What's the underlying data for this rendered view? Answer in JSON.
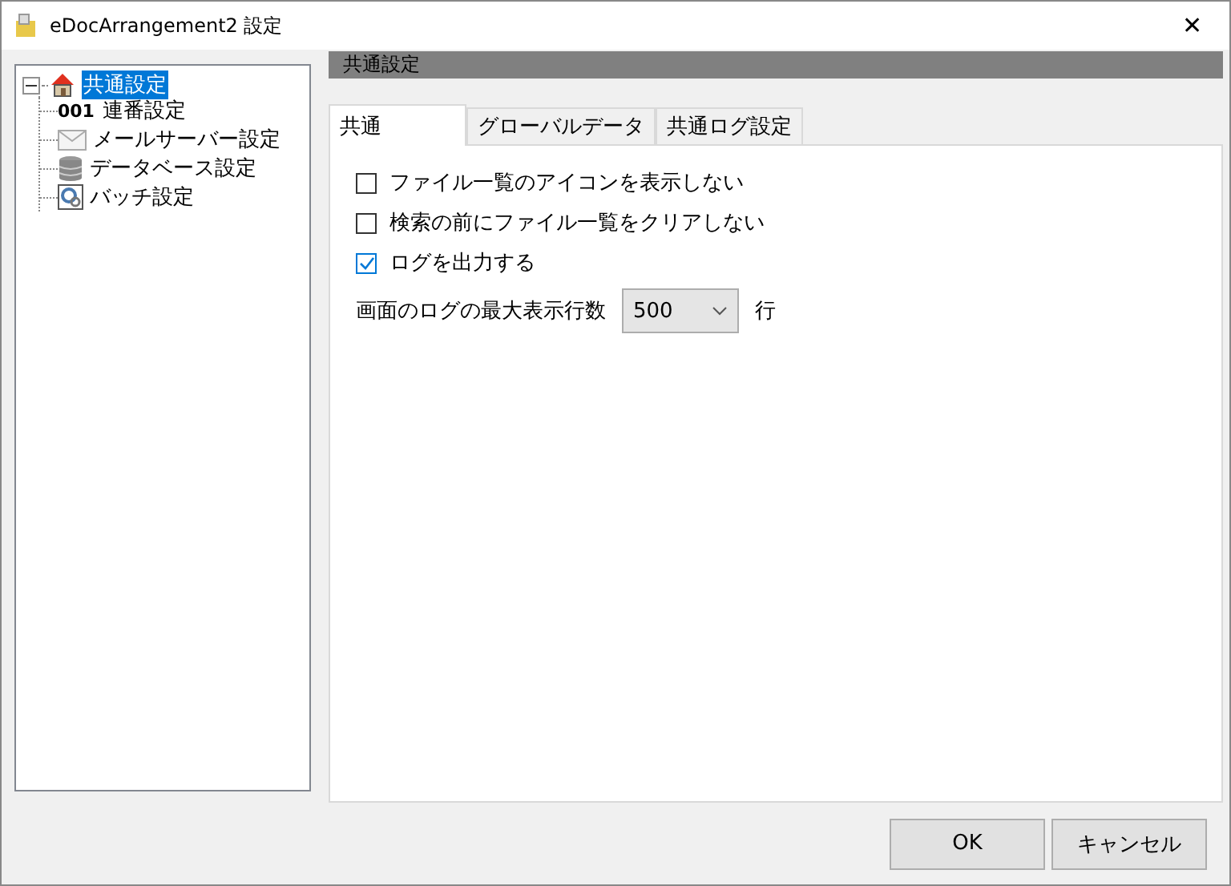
{
  "window": {
    "title": "eDocArrangement2 設定",
    "close": "✕"
  },
  "tree": [
    {
      "label": "共通設定",
      "kind": "house",
      "selected": true,
      "expanded": true,
      "children": [
        {
          "label": "連番設定",
          "badge": "001",
          "selected": false
        },
        {
          "label": "メールサーバー設定",
          "kind": "mail",
          "selected": false
        },
        {
          "label": "データベース設定",
          "kind": "database",
          "selected": false
        },
        {
          "label": "バッチ設定",
          "kind": "gear",
          "selected": false
        }
      ]
    }
  ],
  "section_header": "共通設定",
  "tabs": [
    {
      "label": "共通",
      "selected": true
    },
    {
      "label": "グローバルデータ",
      "selected": false
    },
    {
      "label": "共通ログ設定",
      "selected": false
    }
  ],
  "options": [
    {
      "label": "ファイル一覧のアイコンを表示しない",
      "checked": false
    },
    {
      "label": "検索の前にファイル一覧をクリアしない",
      "checked": false
    },
    {
      "label": "ログを出力する",
      "checked": true
    }
  ],
  "max_lines": {
    "label": "画面のログの最大表示行数",
    "value": "500",
    "unit": "行"
  },
  "buttons": [
    "OK",
    "キャンセル"
  ]
}
